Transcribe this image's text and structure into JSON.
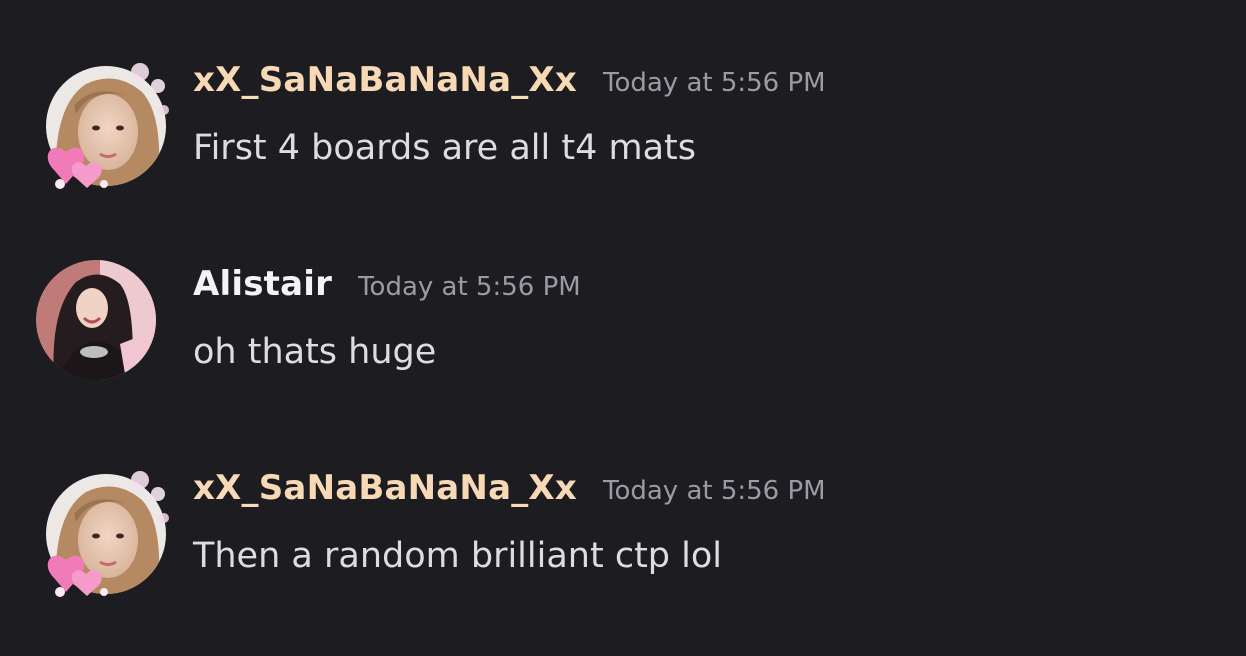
{
  "colors": {
    "background": "#1c1c21",
    "username_highlight": "#f8d9b6",
    "username_default": "#f3f4f6",
    "timestamp": "#9a9ba3",
    "message_text": "#dcdde2"
  },
  "messages": [
    {
      "username": "xX_SaNaBaNaNa_Xx",
      "timestamp": "Today at 5:56 PM",
      "content": "First 4 boards are all t4 mats",
      "avatar": "avatar-with-heart-decoration"
    },
    {
      "username": "Alistair",
      "timestamp": "Today at 5:56 PM",
      "content": "oh thats huge",
      "avatar": "avatar-photo"
    },
    {
      "username": "xX_SaNaBaNaNa_Xx",
      "timestamp": "Today at 5:56 PM",
      "content": "Then a random brilliant ctp lol",
      "avatar": "avatar-with-heart-decoration"
    }
  ]
}
